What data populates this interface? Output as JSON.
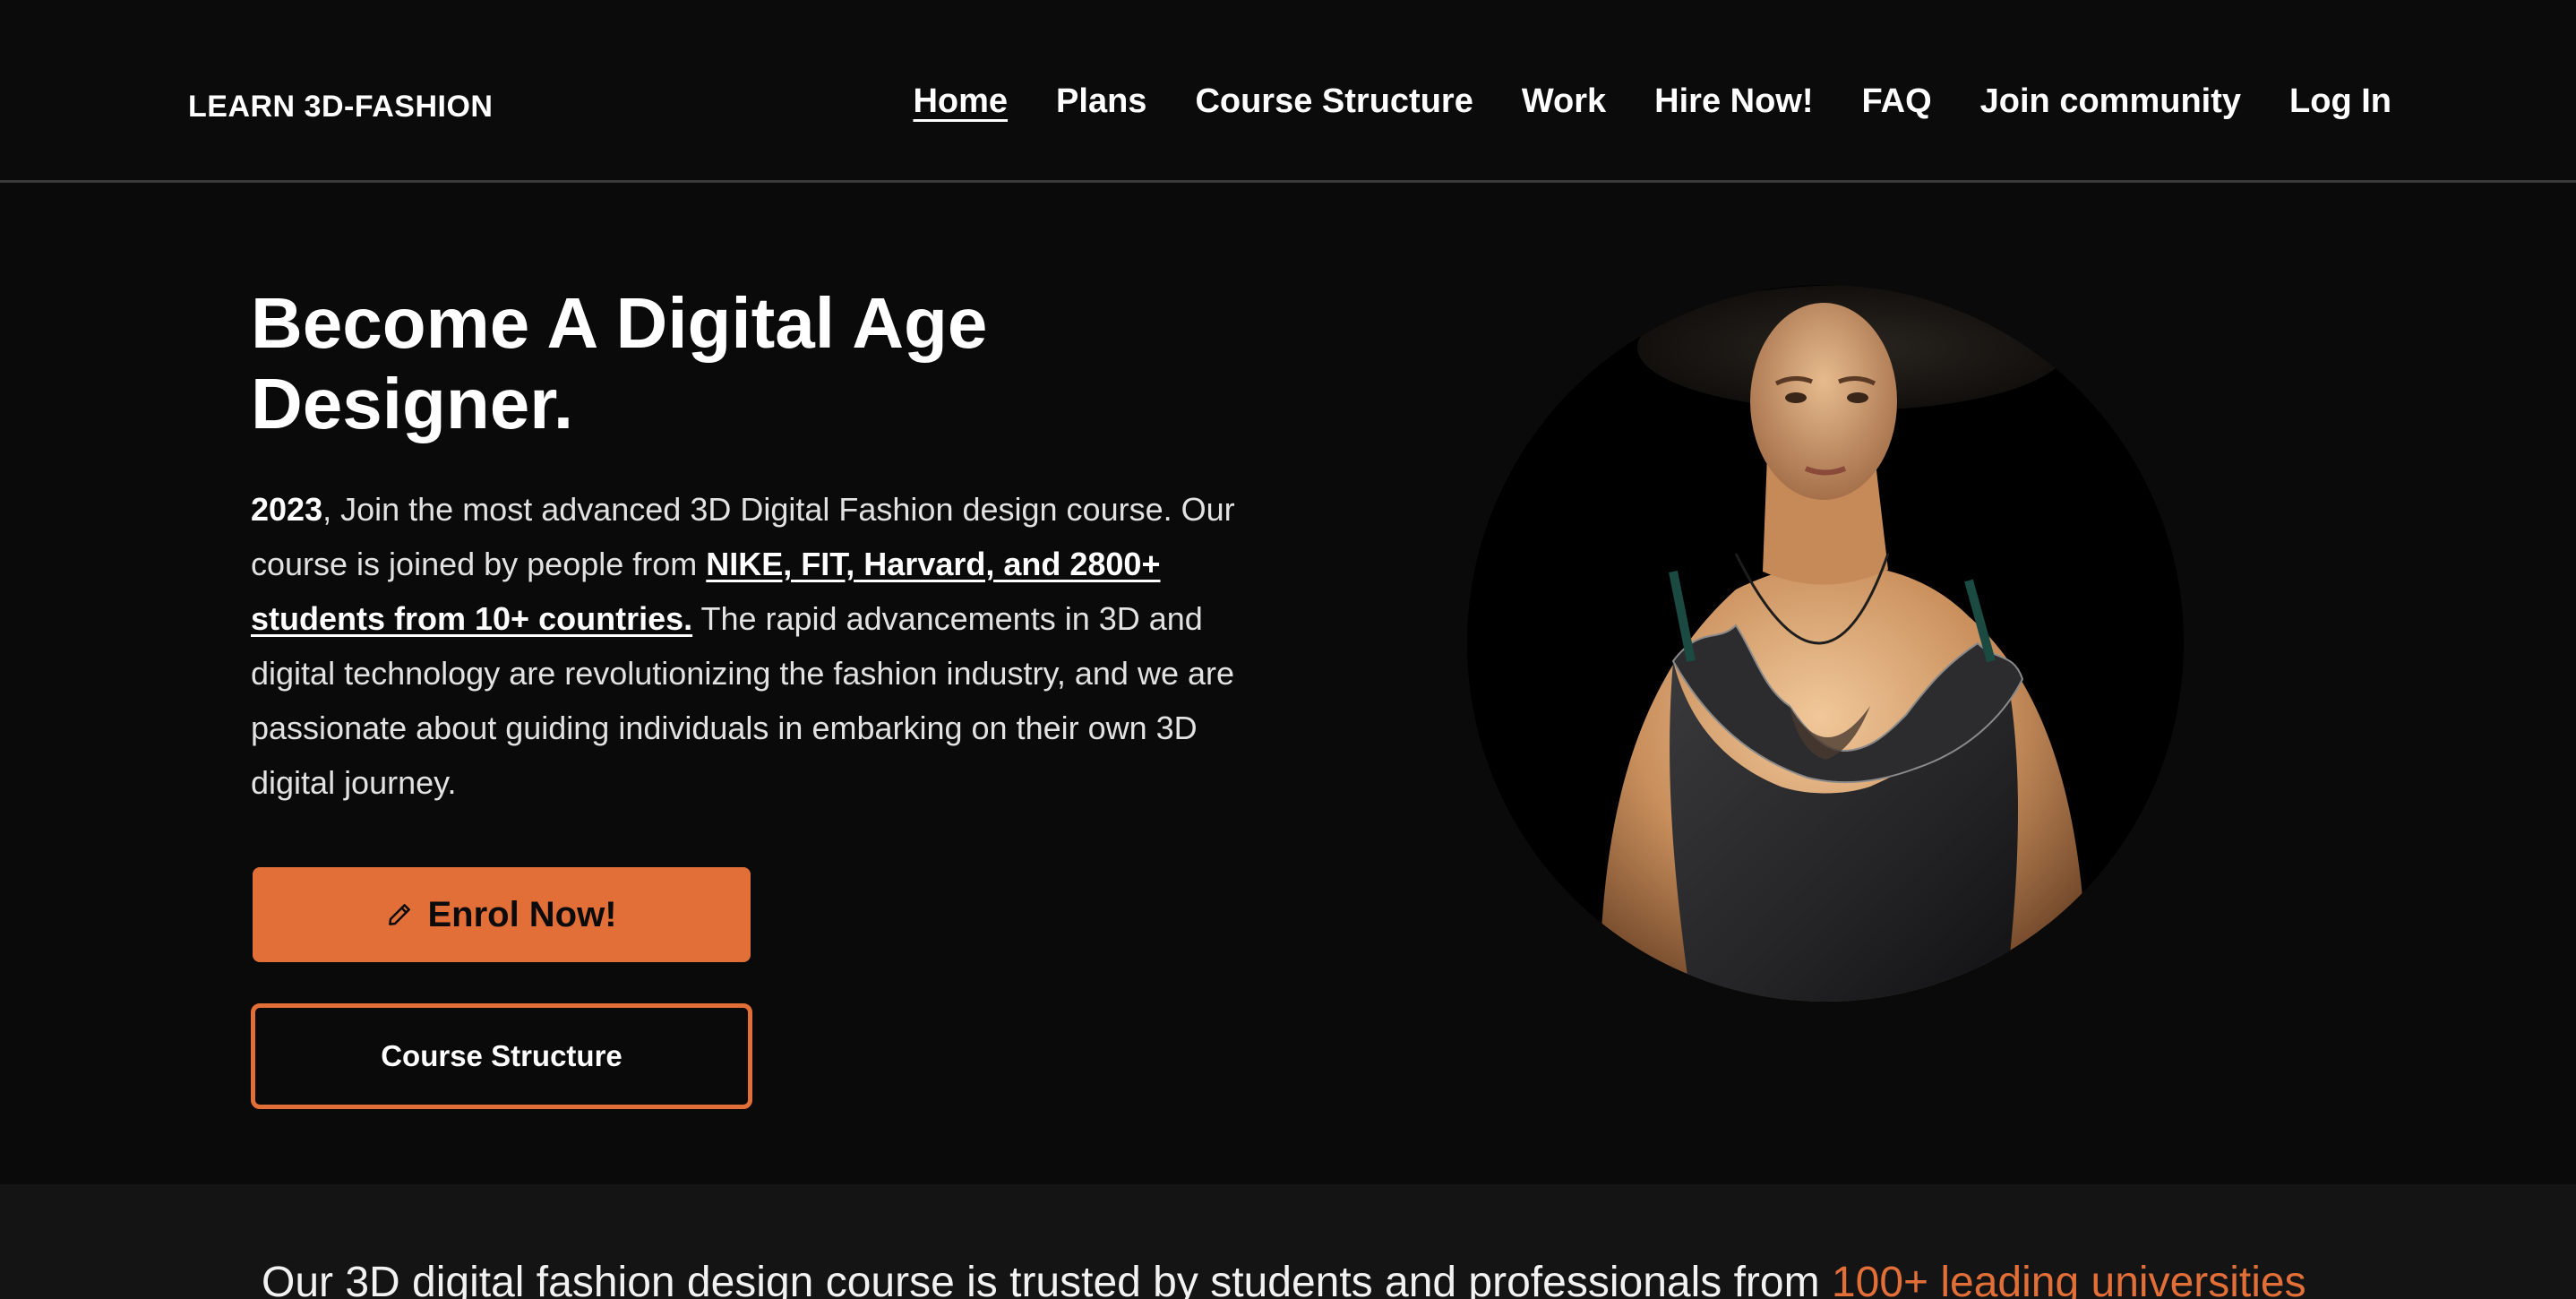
{
  "brand": {
    "logo_text": "LEARN 3D-FASHION",
    "accent_color": "#e36f38",
    "background_color": "#0a0a0a"
  },
  "nav": {
    "items": [
      {
        "label": "Home",
        "active": true
      },
      {
        "label": "Plans",
        "active": false
      },
      {
        "label": "Course Structure",
        "active": false
      },
      {
        "label": "Work",
        "active": false
      },
      {
        "label": "Hire Now!",
        "active": false
      },
      {
        "label": "FAQ",
        "active": false
      },
      {
        "label": "Join community",
        "active": false
      },
      {
        "label": "Log In",
        "active": false
      }
    ]
  },
  "hero": {
    "title": "Become A Digital Age Designer.",
    "text": {
      "year": "2023",
      "part1": ", Join the most advanced 3D Digital Fashion design course. Our course is joined by people from ",
      "link": "NIKE, FIT, Harvard, and 2800+ students from 10+ countries.",
      "part2": " The rapid advancements in 3D and digital technology are revolutionizing the fashion industry, and we are passionate about guiding individuals in embarking on their own 3D digital journey."
    },
    "enrol_button": {
      "label": "Enrol Now!",
      "icon": "pencil-icon"
    },
    "structure_button": {
      "label": "Course Structure"
    },
    "image_subject": "3D rendered female model in black ruffled dress and wide-brim hat"
  },
  "trusted": {
    "text": "Our 3D digital fashion design course is trusted by students and professionals from ",
    "highlight": "100+ leading universities"
  }
}
